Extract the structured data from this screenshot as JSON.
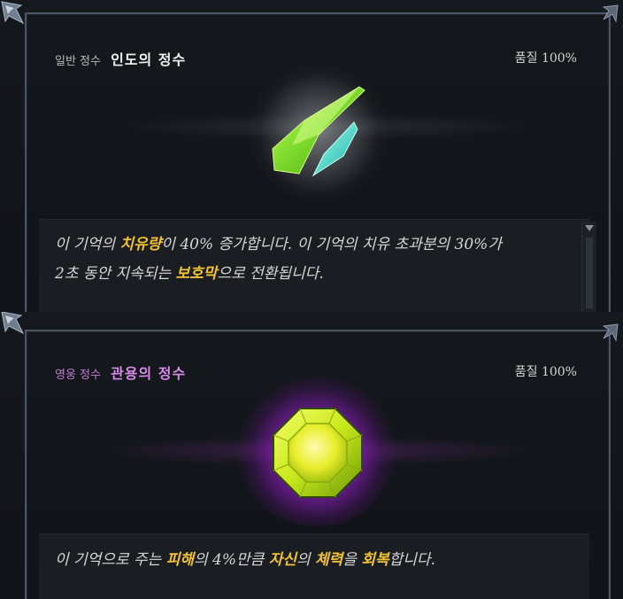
{
  "cards": [
    {
      "grade": "일반 정수",
      "name": "인도의 정수",
      "quality": "품질 100%",
      "desc_line1": [
        "이 기억의 ",
        "치유량",
        "이 40% 증가합니다. 이 기억의 치유 초과분의 30%가"
      ],
      "desc_line2": [
        "2초 동안 지속되는 ",
        "보호막",
        "으로 전환됩니다."
      ]
    },
    {
      "grade": "영웅 정수",
      "name": "관용의 정수",
      "quality": "품질 100%",
      "desc": [
        "이 기억으로 주는 ",
        "피해",
        "의 4%만큼 ",
        "자신",
        "의 ",
        "체력",
        "을 ",
        "회복",
        "합니다."
      ]
    }
  ],
  "colors": {
    "highlight": "#f2c233",
    "hero_grade": "#c77ad6",
    "frame": "#4b5766"
  },
  "icons": [
    "green-crystal-shards-icon",
    "yellow-octagon-gem-icon",
    "scroll-down-arrow-icon"
  ]
}
